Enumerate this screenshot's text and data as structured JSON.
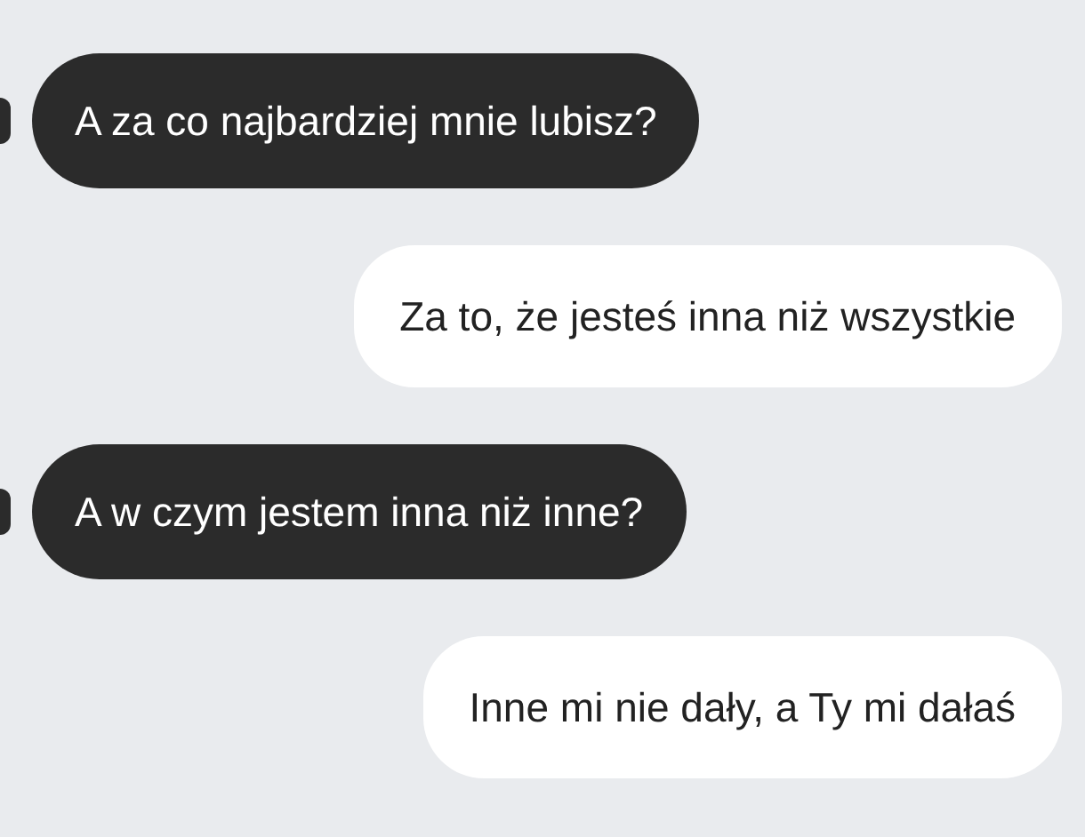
{
  "messages": [
    {
      "kind": "received",
      "text": "A za co najbardziej mnie lubisz?"
    },
    {
      "kind": "sent",
      "text": "Za to, że jesteś inna niż wszystkie"
    },
    {
      "kind": "received",
      "text": "A w czym jestem inna niż inne?"
    },
    {
      "kind": "sent",
      "text": "Inne mi nie dały, a Ty mi dałaś"
    }
  ]
}
